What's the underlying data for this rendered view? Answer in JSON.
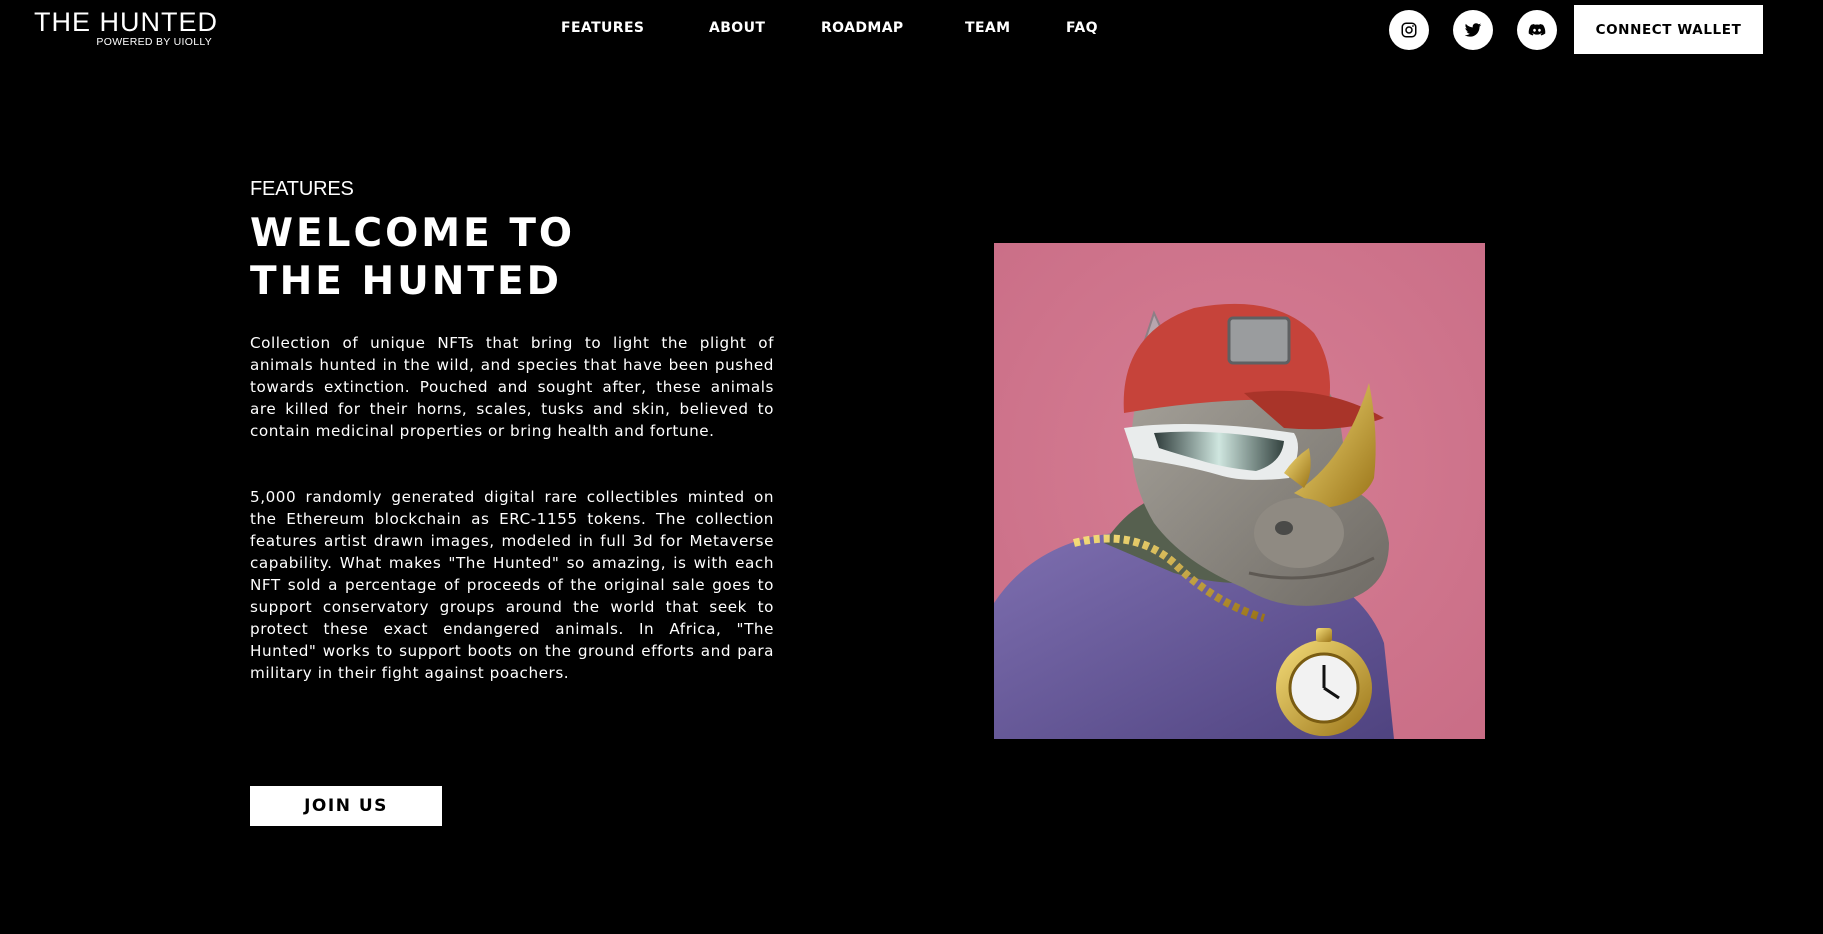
{
  "header": {
    "logo_title": "THE HUNTED",
    "logo_subtitle": "POWERED BY UIOLLY",
    "nav": [
      {
        "label": "FEATURES"
      },
      {
        "label": "ABOUT"
      },
      {
        "label": "ROADMAP"
      },
      {
        "label": "TEAM"
      },
      {
        "label": "FAQ"
      }
    ],
    "social": [
      {
        "icon": "instagram-icon"
      },
      {
        "icon": "twitter-icon"
      },
      {
        "icon": "discord-icon"
      }
    ],
    "connect_label": "CONNECT WALLET"
  },
  "main": {
    "eyebrow": "FEATURES",
    "headline_line1": "WELCOME TO",
    "headline_line2": "THE HUNTED",
    "paragraph1": "Collection of unique NFTs that bring to light the plight of animals hunted in the wild, and species that have been pushed towards extinction. Pouched and sought after, these animals are killed for their horns, scales, tusks and skin, believed to contain medicinal properties or bring health and fortune.",
    "paragraph2": "5,000 randomly generated digital rare collectibles minted on the Ethereum blockchain as ERC-1155 tokens. The collection features artist drawn images, modeled in full 3d for Metaverse capability. What makes \"The Hunted\" so amazing, is with each NFT sold a percentage of proceeds of the original sale goes to support conservatory groups around the world that seek to protect these exact endangered animals. In Africa, \"The Hunted\" works to support boots on the ground efforts and para military in their fight against poachers.",
    "join_label": "JOIN US"
  },
  "colors": {
    "background": "#000000",
    "text": "#ffffff",
    "hero_background": "#d27790"
  }
}
